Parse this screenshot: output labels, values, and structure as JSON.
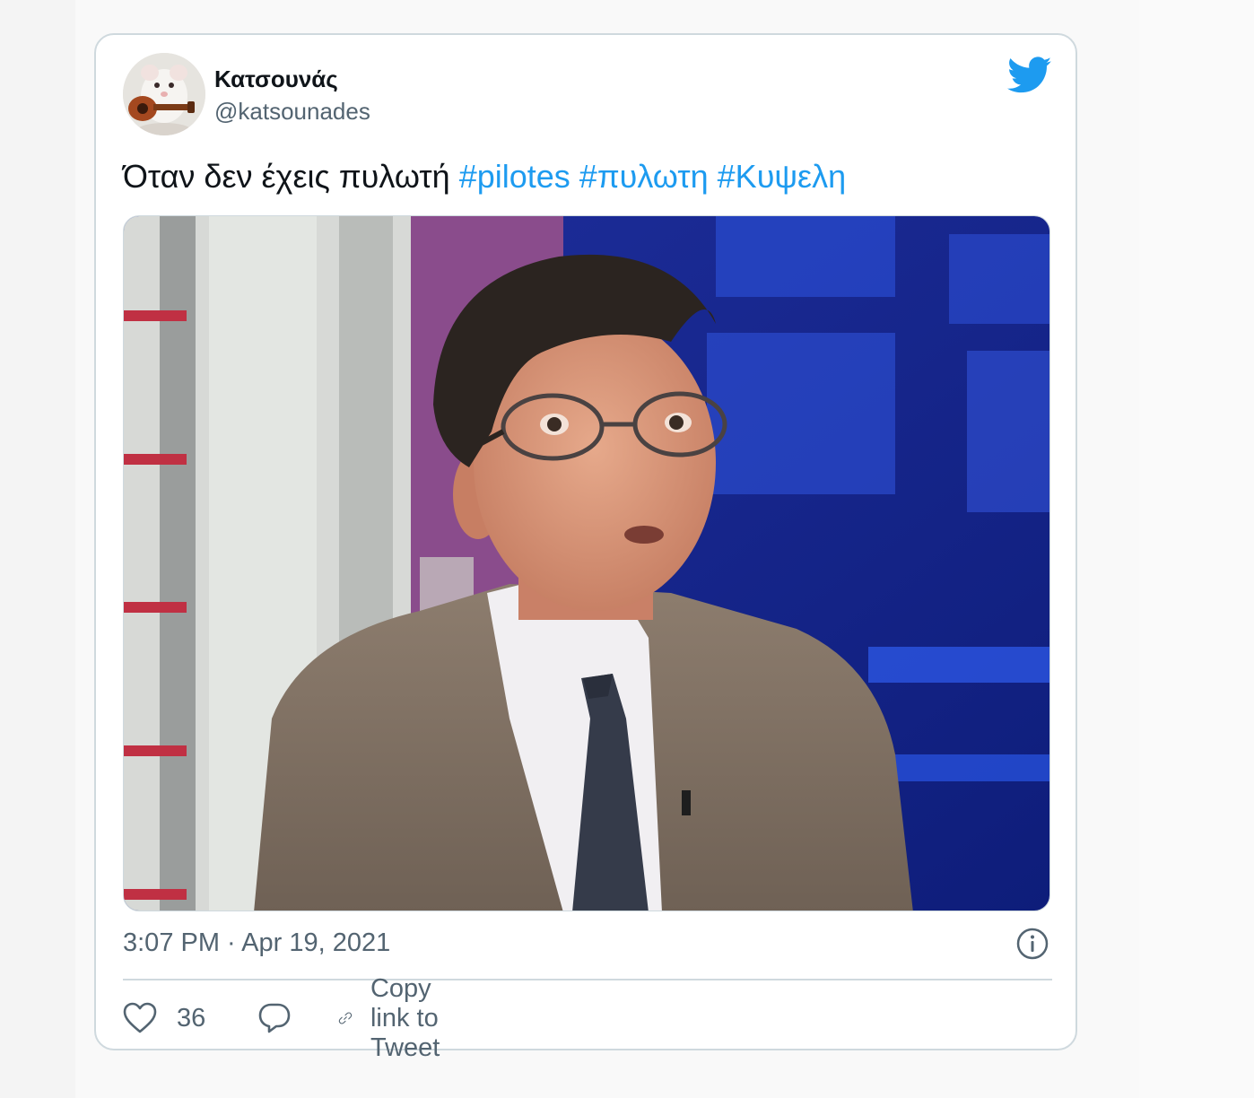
{
  "tweet": {
    "author": {
      "display_name": "Κατσουνάς",
      "handle": "@katsounades"
    },
    "text_plain": "Όταν δεν έχεις πυλωτή",
    "hashtags": [
      "#pilotes",
      "#πυλωτη",
      "#Κυψελη"
    ],
    "timestamp": "3:07 PM · Apr 19, 2021",
    "actions": {
      "like_count": "36",
      "copy_link_label": "Copy link to Tweet"
    }
  },
  "icons": {
    "brand": "twitter-bird-icon",
    "info": "info-icon",
    "like": "heart-icon",
    "reply": "reply-bubble-icon",
    "link": "link-icon"
  },
  "colors": {
    "brand_blue": "#1d9bf0",
    "secondary_text": "#536471",
    "primary_text": "#0f1419",
    "border": "#cfd9de"
  }
}
